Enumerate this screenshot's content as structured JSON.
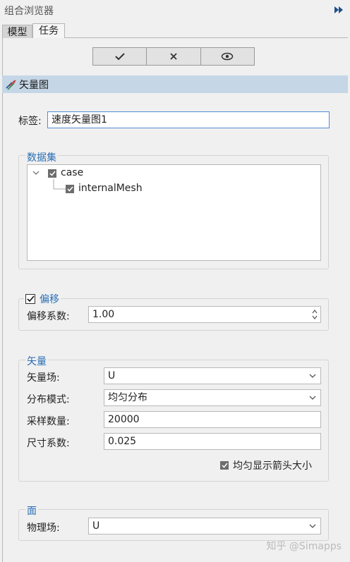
{
  "window": {
    "title": "组合浏览器"
  },
  "tabs": [
    {
      "label": "模型"
    },
    {
      "label": "任务"
    }
  ],
  "toolbar": {
    "ok_icon": "check-icon",
    "cancel_icon": "close-icon",
    "preview_icon": "eye-icon"
  },
  "section": {
    "title": "矢量图",
    "icon": "vector-plot-icon"
  },
  "label_field": {
    "label": "标签:",
    "value": "速度矢量图1"
  },
  "dataset": {
    "title": "数据集",
    "tree": [
      {
        "label": "case",
        "checked": true
      },
      {
        "label": "internalMesh",
        "checked": true
      }
    ]
  },
  "offset": {
    "title": "偏移",
    "checked": true,
    "coef_label": "偏移系数:",
    "coef_value": "1.00"
  },
  "vector": {
    "title": "矢量",
    "field_label": "矢量场:",
    "field_value": "U",
    "mode_label": "分布模式:",
    "mode_value": "均匀分布",
    "samples_label": "采样数量:",
    "samples_value": "20000",
    "scale_label": "尺寸系数:",
    "scale_value": "0.025",
    "uniform_label": "均匀显示箭头大小",
    "uniform_checked": true
  },
  "surface": {
    "title": "面",
    "field_label": "物理场:",
    "field_value": "U"
  },
  "watermark": "知乎 @Simapps",
  "colors": {
    "accent": "#2a6fb5",
    "header_bg": "#c5d6e6",
    "active_border": "#4f8ed6"
  }
}
